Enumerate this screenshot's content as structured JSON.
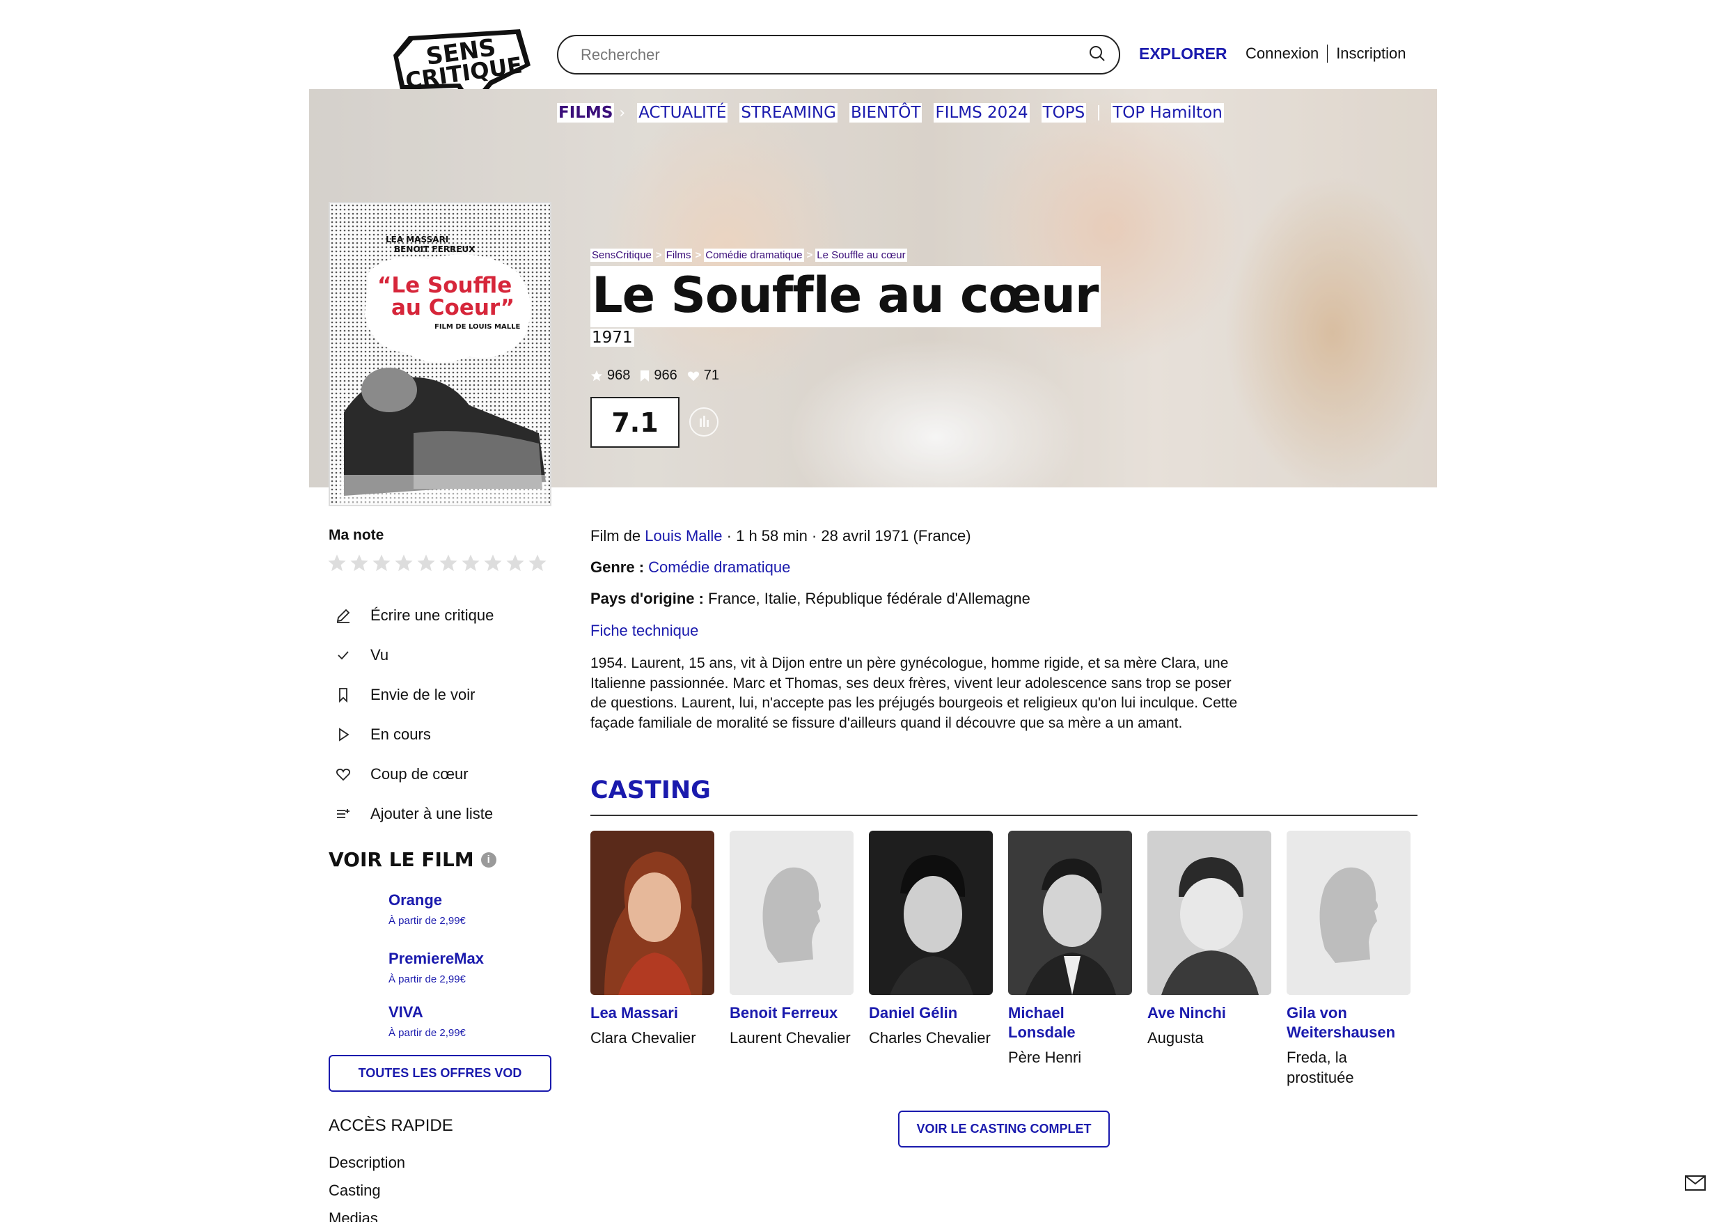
{
  "header": {
    "logo_text_1": "SENS",
    "logo_text_2": "CRITIQUE",
    "search_placeholder": "Rechercher",
    "explorer": "EXPLORER",
    "login": "Connexion",
    "signup": "Inscription"
  },
  "nav": {
    "films": "FILMS",
    "items": [
      "ACTUALITÉ",
      "STREAMING",
      "BIENTÔT",
      "FILMS 2024",
      "TOPS"
    ],
    "top": "TOP Hamilton"
  },
  "breadcrumb": [
    "SensCritique",
    "Films",
    "Comédie dramatique",
    "Le Souffle au cœur"
  ],
  "movie": {
    "title": "Le Souffle au cœur",
    "year": "1971",
    "stats": {
      "ratings": "968",
      "wishlist": "966",
      "favorites": "71"
    },
    "score": "7.1",
    "poster": {
      "actors_top_1": "LEA MASSARI",
      "actors_top_2": "BENOIT FERREUX",
      "title_1": "“Le Souffle",
      "title_2": "au Coeur”",
      "subtitle": "FILM DE LOUIS MALLE"
    },
    "director_prefix": "Film de",
    "director": "Louis Malle",
    "details": "· 1 h 58 min · 28 avril 1971 (France)",
    "genre_label": "Genre :",
    "genre": "Comédie dramatique",
    "country_label": "Pays d'origine :",
    "countries": "France, Italie, République fédérale d'Allemagne",
    "fiche": "Fiche technique",
    "synopsis": "1954. Laurent, 15 ans, vit à Dijon entre un père gynécologue, homme rigide, et sa mère Clara, une Italienne passionnée. Marc et Thomas, ses deux frères, vivent leur adolescence sans trop se poser de questions. Laurent, lui, n'accepte pas les préjugés bourgeois et religieux qu'on lui inculque. Cette façade familiale de moralité se fissure d'ailleurs quand il découvre que sa mère a un amant."
  },
  "sidebar": {
    "my_rating": "Ma note",
    "actions": [
      "Écrire une critique",
      "Vu",
      "Envie de le voir",
      "En cours",
      "Coup de cœur",
      "Ajouter à une liste"
    ],
    "watch_title": "VOIR LE FILM",
    "watch_info": "i",
    "vod": [
      {
        "name": "Orange",
        "price": "À partir de 2,99€"
      },
      {
        "name": "PremiereMax",
        "price": "À partir de 2,99€"
      },
      {
        "name": "VIVA",
        "price": "À partir de 2,99€"
      }
    ],
    "vod_button": "TOUTES LES OFFRES VOD",
    "quick_access": "ACCÈS RAPIDE",
    "quick_links": [
      "Description",
      "Casting",
      "Medias"
    ]
  },
  "casting": {
    "title": "CASTING",
    "cast": [
      {
        "name": "Lea Massari",
        "role": "Clara Chevalier"
      },
      {
        "name": "Benoit Ferreux",
        "role": "Laurent Chevalier"
      },
      {
        "name": "Daniel Gélin",
        "role": "Charles Chevalier"
      },
      {
        "name": "Michael Lonsdale",
        "role": "Père Henri"
      },
      {
        "name": "Ave Ninchi",
        "role": "Augusta"
      },
      {
        "name": "Gila von Weitershausen",
        "role": "Freda, la prostituée"
      }
    ],
    "button": "VOIR LE CASTING COMPLET"
  },
  "colors": {
    "accent": "#1a1aad",
    "nav_active": "#3b0f7a"
  }
}
